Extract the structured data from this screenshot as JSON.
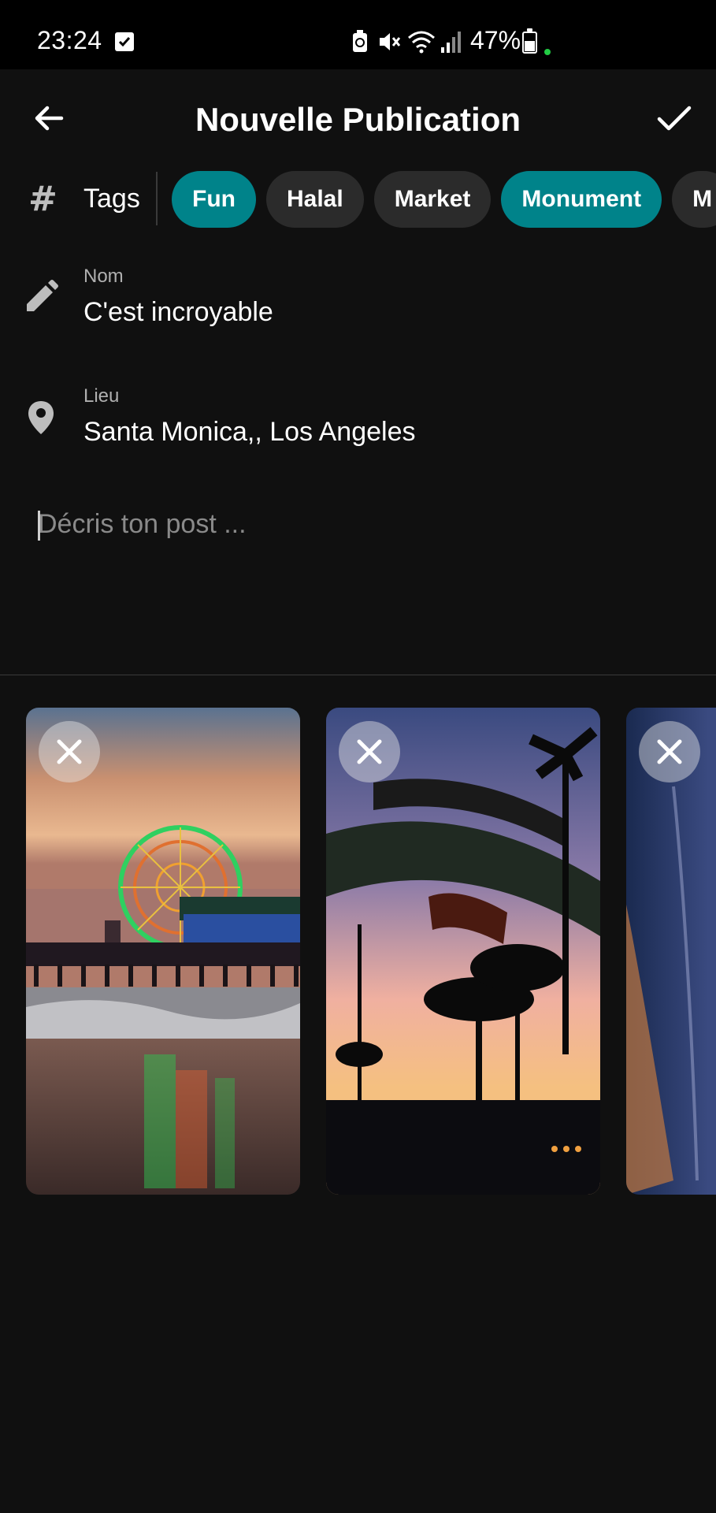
{
  "status_bar": {
    "time": "23:24",
    "battery": "47%",
    "icons": [
      "calendar-check-icon",
      "battery-saver-icon",
      "mute-icon",
      "wifi-icon",
      "signal-icon",
      "battery-icon"
    ]
  },
  "header": {
    "title": "Nouvelle Publication",
    "back_icon": "arrow-left-icon",
    "confirm_icon": "check-icon"
  },
  "tags": {
    "icon": "hash-icon",
    "label": "Tags",
    "chips": [
      {
        "label": "Fun",
        "selected": true
      },
      {
        "label": "Halal",
        "selected": false
      },
      {
        "label": "Market",
        "selected": false
      },
      {
        "label": "Monument",
        "selected": true
      },
      {
        "label": "M",
        "selected": false
      }
    ]
  },
  "name_field": {
    "icon": "pencil-icon",
    "label": "Nom",
    "value": "C'est incroyable"
  },
  "location_field": {
    "icon": "location-pin-icon",
    "label": "Lieu",
    "value": "Santa Monica,, Los Angeles"
  },
  "description": {
    "placeholder": "Décris ton post ..."
  },
  "images": [
    {
      "subject": "ferris-wheel-pier-sunset",
      "remove_icon": "close-icon"
    },
    {
      "subject": "santa-monica-yacht-harbor-sign",
      "remove_icon": "close-icon"
    },
    {
      "subject": "pier-night-partial",
      "remove_icon": "close-icon"
    }
  ],
  "colors": {
    "background": "#101010",
    "status_bar": "#000000",
    "chip": "#2b2b2b",
    "chip_selected": "#00838a",
    "text": "#ffffff",
    "secondary_text": "#b0b0b0"
  }
}
